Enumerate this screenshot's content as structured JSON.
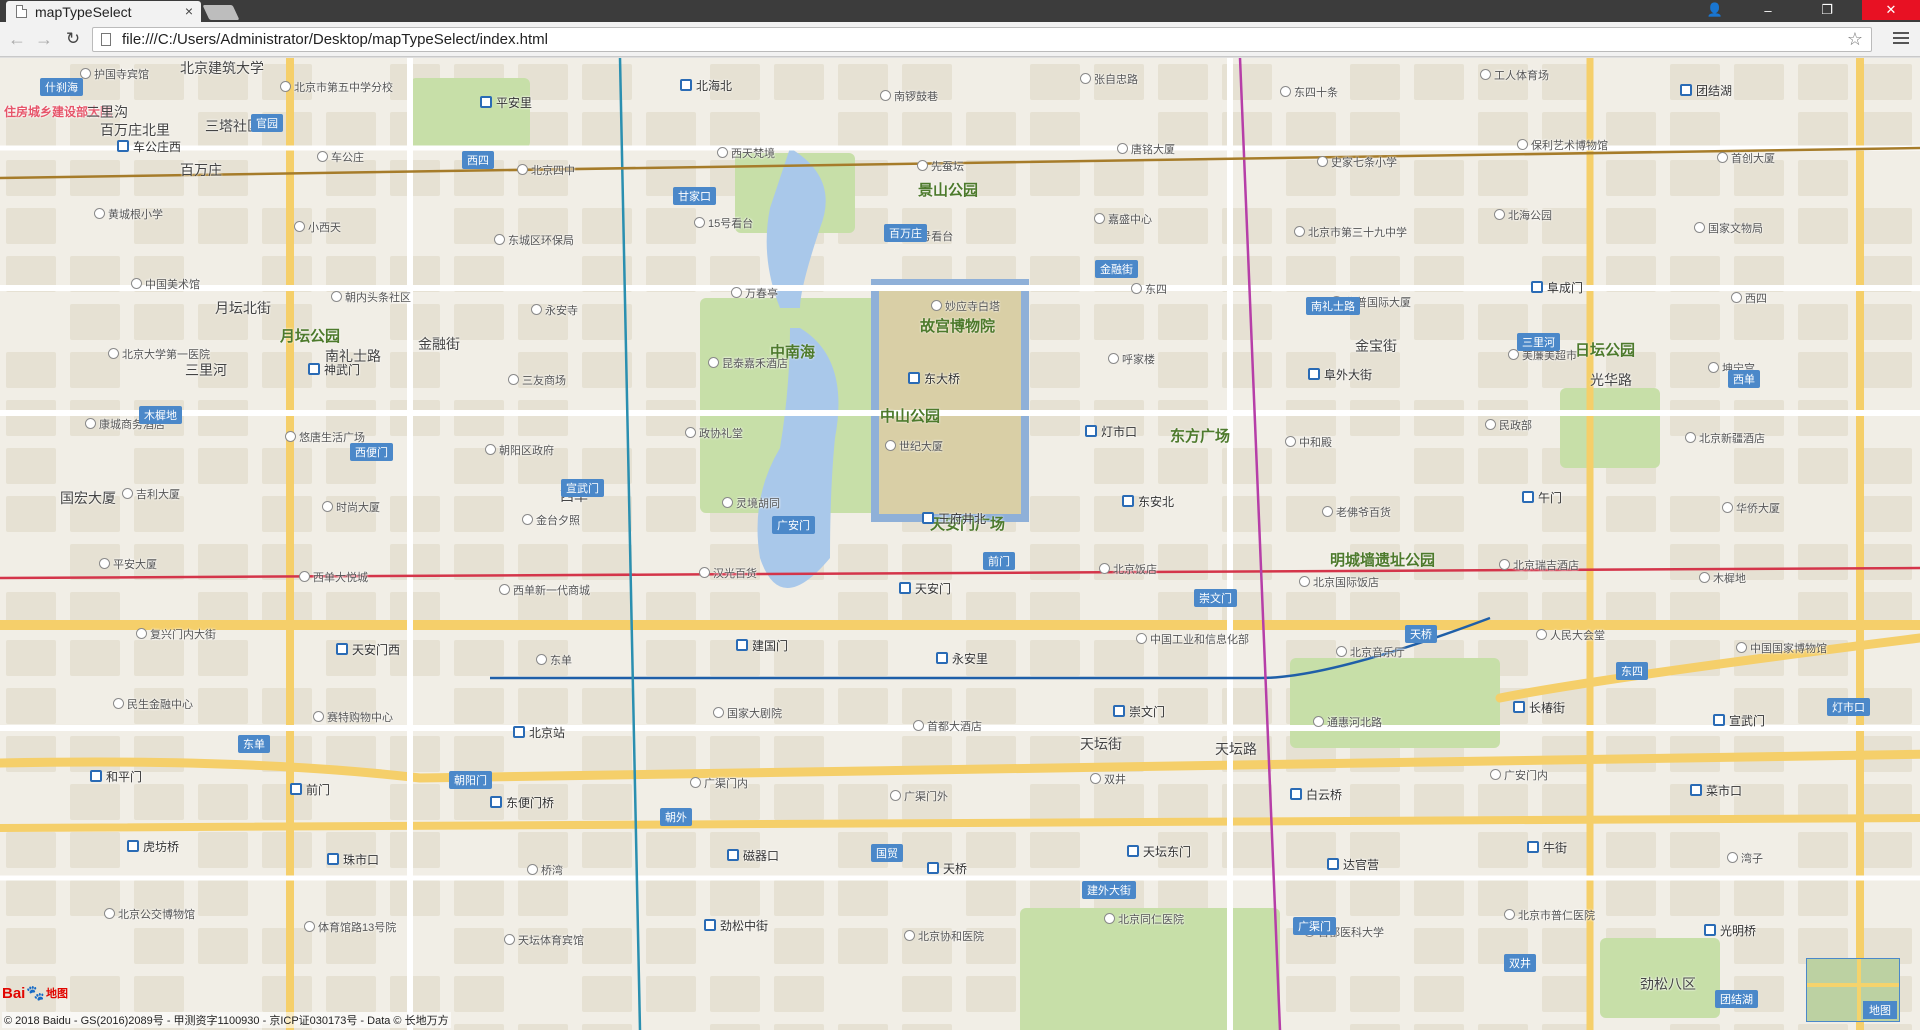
{
  "browser": {
    "tab_title": "mapTypeSelect",
    "tab_close": "×",
    "url": "file:///C:/Users/Administrator/Desktop/mapTypeSelect/index.html",
    "window_min": "–",
    "window_max": "❐",
    "window_close": "✕",
    "back": "←",
    "forward": "→",
    "reload": "↻",
    "star": "☆",
    "user": "👤"
  },
  "map": {
    "colors": {
      "background": "#f1eee6",
      "block": "#e6e1d3",
      "park": "#c7dfa8",
      "water": "#a9c8ea",
      "arterial": "#f5cf6a",
      "road": "#ffffff",
      "metro_line1": "#d4354a",
      "metro_line2": "#1f5fa8",
      "metro_line4": "#2a8fb0",
      "metro_line5": "#b63ea8",
      "metro_line6": "#a67c2a"
    },
    "districts": [
      {
        "name": "住房城乡建设部大院"
      },
      {
        "name": "北京建筑大学"
      },
      {
        "name": "二里沟"
      },
      {
        "name": "百万庄北里"
      },
      {
        "name": "三塔社区"
      },
      {
        "name": "百万庄"
      },
      {
        "name": "国宏大厦"
      },
      {
        "name": "月坛北街"
      },
      {
        "name": "月坛公园"
      },
      {
        "name": "南礼士路"
      },
      {
        "name": "三里河"
      },
      {
        "name": "金融街"
      },
      {
        "name": "西单"
      },
      {
        "name": "中南海"
      },
      {
        "name": "故宫博物院"
      },
      {
        "name": "景山公园"
      },
      {
        "name": "中山公园"
      },
      {
        "name": "天安门广场"
      },
      {
        "name": "东方广场"
      },
      {
        "name": "金宝街"
      },
      {
        "name": "日坛公园"
      },
      {
        "name": "明城墙遗址公园"
      },
      {
        "name": "天坛路"
      },
      {
        "name": "天坛街"
      },
      {
        "name": "光华路"
      },
      {
        "name": "劲松八区"
      }
    ],
    "labels": [
      {
        "text": "护国寺宾馆"
      },
      {
        "text": "北京市第五中学分校"
      },
      {
        "text": "平安里"
      },
      {
        "text": "北海北"
      },
      {
        "text": "南锣鼓巷"
      },
      {
        "text": "张自忠路"
      },
      {
        "text": "东四十条"
      },
      {
        "text": "工人体育场"
      },
      {
        "text": "团结湖"
      },
      {
        "text": "车公庄西"
      },
      {
        "text": "车公庄"
      },
      {
        "text": "北京四中"
      },
      {
        "text": "西天梵境"
      },
      {
        "text": "先蚕坛"
      },
      {
        "text": "唐铭大厦"
      },
      {
        "text": "史家七条小学"
      },
      {
        "text": "保利艺术博物馆"
      },
      {
        "text": "首创大厦"
      },
      {
        "text": "黄城根小学"
      },
      {
        "text": "小西天"
      },
      {
        "text": "东城区环保局"
      },
      {
        "text": "15号看台"
      },
      {
        "text": "10号看台"
      },
      {
        "text": "嘉盛中心"
      },
      {
        "text": "北京市第三十九中学"
      },
      {
        "text": "北海公园"
      },
      {
        "text": "国家文物局"
      },
      {
        "text": "中国美术馆"
      },
      {
        "text": "朝内头条社区"
      },
      {
        "text": "永安寺"
      },
      {
        "text": "万春亭"
      },
      {
        "text": "妙应寺白塔"
      },
      {
        "text": "东四"
      },
      {
        "text": "华普国际大厦"
      },
      {
        "text": "阜成门"
      },
      {
        "text": "西四"
      },
      {
        "text": "北京大学第一医院"
      },
      {
        "text": "神武门"
      },
      {
        "text": "三友商场"
      },
      {
        "text": "昆泰嘉禾酒店"
      },
      {
        "text": "东大桥"
      },
      {
        "text": "呼家楼"
      },
      {
        "text": "阜外大街"
      },
      {
        "text": "美廉美超市"
      },
      {
        "text": "坤宁宫"
      },
      {
        "text": "康城商务酒店"
      },
      {
        "text": "悠唐生活广场"
      },
      {
        "text": "朝阳区政府"
      },
      {
        "text": "政协礼堂"
      },
      {
        "text": "世纪大厦"
      },
      {
        "text": "灯市口"
      },
      {
        "text": "中和殿"
      },
      {
        "text": "民政部"
      },
      {
        "text": "北京新疆酒店"
      },
      {
        "text": "吉利大厦"
      },
      {
        "text": "时尚大厦"
      },
      {
        "text": "金台夕照"
      },
      {
        "text": "灵境胡同"
      },
      {
        "text": "王府井北"
      },
      {
        "text": "东安北"
      },
      {
        "text": "老佛爷百货"
      },
      {
        "text": "午门"
      },
      {
        "text": "华侨大厦"
      },
      {
        "text": "平安大厦"
      },
      {
        "text": "西单大悦城"
      },
      {
        "text": "西单新一代商城"
      },
      {
        "text": "汉光百货"
      },
      {
        "text": "天安门"
      },
      {
        "text": "北京饭店"
      },
      {
        "text": "北京国际饭店"
      },
      {
        "text": "北京瑞吉酒店"
      },
      {
        "text": "木樨地"
      },
      {
        "text": "复兴门内大街"
      },
      {
        "text": "天安门西"
      },
      {
        "text": "东单"
      },
      {
        "text": "建国门"
      },
      {
        "text": "永安里"
      },
      {
        "text": "中国工业和信息化部"
      },
      {
        "text": "北京音乐厅"
      },
      {
        "text": "人民大会堂"
      },
      {
        "text": "中国国家博物馆"
      },
      {
        "text": "民生金融中心"
      },
      {
        "text": "赛特购物中心"
      },
      {
        "text": "北京站"
      },
      {
        "text": "国家大剧院"
      },
      {
        "text": "首都大酒店"
      },
      {
        "text": "崇文门"
      },
      {
        "text": "通惠河北路"
      },
      {
        "text": "长椿街"
      },
      {
        "text": "宣武门"
      },
      {
        "text": "和平门"
      },
      {
        "text": "前门"
      },
      {
        "text": "东便门桥"
      },
      {
        "text": "广渠门内"
      },
      {
        "text": "广渠门外"
      },
      {
        "text": "双井"
      },
      {
        "text": "白云桥"
      },
      {
        "text": "广安门内"
      },
      {
        "text": "菜市口"
      },
      {
        "text": "虎坊桥"
      },
      {
        "text": "珠市口"
      },
      {
        "text": "桥湾"
      },
      {
        "text": "磁器口"
      },
      {
        "text": "天桥"
      },
      {
        "text": "天坛东门"
      },
      {
        "text": "达官营"
      },
      {
        "text": "牛街"
      },
      {
        "text": "湾子"
      },
      {
        "text": "北京公交博物馆"
      },
      {
        "text": "体育馆路13号院"
      },
      {
        "text": "天坛体育宾馆"
      },
      {
        "text": "劲松中街"
      },
      {
        "text": "北京协和医院"
      },
      {
        "text": "北京同仁医院"
      },
      {
        "text": "首都医科大学"
      },
      {
        "text": "北京市普仁医院"
      },
      {
        "text": "光明桥"
      }
    ],
    "metro_signs": [
      {
        "text": "什刹海"
      },
      {
        "text": "官园"
      },
      {
        "text": "西四"
      },
      {
        "text": "甘家口"
      },
      {
        "text": "百万庄"
      },
      {
        "text": "金融街"
      },
      {
        "text": "南礼士路"
      },
      {
        "text": "三里河"
      },
      {
        "text": "西单"
      },
      {
        "text": "木樨地"
      },
      {
        "text": "西便门"
      },
      {
        "text": "宣武门"
      },
      {
        "text": "广安门"
      },
      {
        "text": "前门"
      },
      {
        "text": "崇文门"
      },
      {
        "text": "天桥"
      },
      {
        "text": "东四"
      },
      {
        "text": "灯市口"
      },
      {
        "text": "东单"
      },
      {
        "text": "朝阳门"
      },
      {
        "text": "朝外"
      },
      {
        "text": "国贸"
      },
      {
        "text": "建外大街"
      },
      {
        "text": "广渠门"
      },
      {
        "text": "双井"
      },
      {
        "text": "团结湖"
      }
    ],
    "copyright": "© 2018 Baidu - GS(2016)2089号 - 甲测资字1100930 - 京ICP证030173号 - Data © 长地万方",
    "logo": {
      "part1": "Bai",
      "paw": "🐾",
      "part2": "地图"
    },
    "maptype_button": "地图"
  }
}
